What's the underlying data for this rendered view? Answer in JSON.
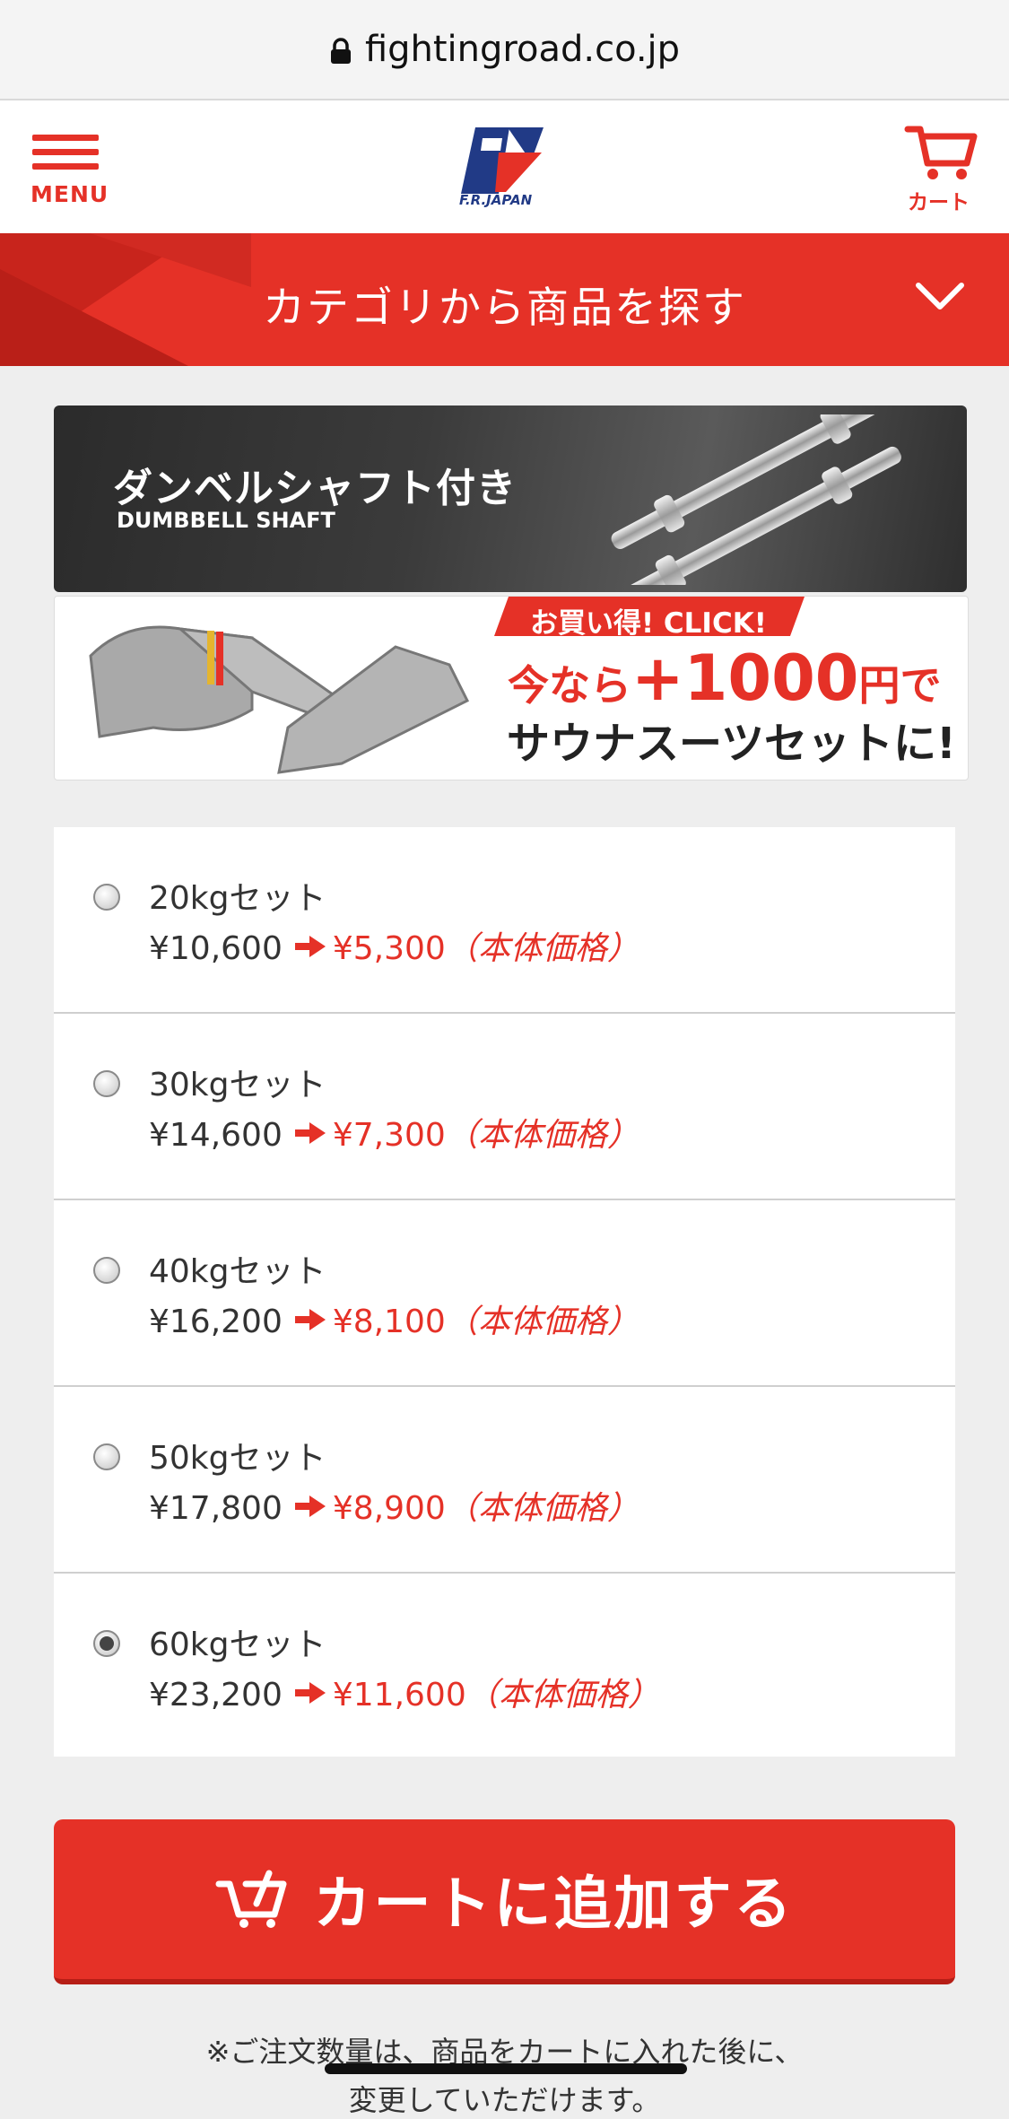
{
  "browser": {
    "url": "fightingroad.co.jp"
  },
  "header": {
    "menu_label": "MENU",
    "logo_text": "F.R.JAPAN",
    "cart_label": "カート"
  },
  "category_bar": {
    "title": "カテゴリから商品を探す"
  },
  "banners": {
    "dumbbell": {
      "title_jp": "ダンベルシャフト付き",
      "title_en": "DUMBBELL SHAFT"
    },
    "sauna": {
      "badge": "お買い得! CLICK!",
      "line1_prefix": "今なら",
      "line1_amount": "+1000",
      "line1_suffix": "円で",
      "line2": "サウナスーツセットに!"
    }
  },
  "options": [
    {
      "name": "20kgセット",
      "orig_price": "¥10,600",
      "sale_price": "¥5,300",
      "tax_note": "（本体価格）",
      "selected": false
    },
    {
      "name": "30kgセット",
      "orig_price": "¥14,600",
      "sale_price": "¥7,300",
      "tax_note": "（本体価格）",
      "selected": false
    },
    {
      "name": "40kgセット",
      "orig_price": "¥16,200",
      "sale_price": "¥8,100",
      "tax_note": "（本体価格）",
      "selected": false
    },
    {
      "name": "50kgセット",
      "orig_price": "¥17,800",
      "sale_price": "¥8,900",
      "tax_note": "（本体価格）",
      "selected": false
    },
    {
      "name": "60kgセット",
      "orig_price": "¥23,200",
      "sale_price": "¥11,600",
      "tax_note": "（本体価格）",
      "selected": true
    }
  ],
  "add_to_cart": {
    "label": "カートに追加する"
  },
  "note": {
    "line1": "※ご注文数量は、商品をカートに入れた後に、",
    "line2": "変更していただけます。"
  },
  "colors": {
    "accent": "#e53127",
    "brand_blue": "#213a86",
    "background": "#eeeeee"
  },
  "icons": [
    "lock-icon",
    "hamburger-menu-icon",
    "fr-japan-logo",
    "cart-icon",
    "chevron-down-icon",
    "arrow-right-icon"
  ]
}
